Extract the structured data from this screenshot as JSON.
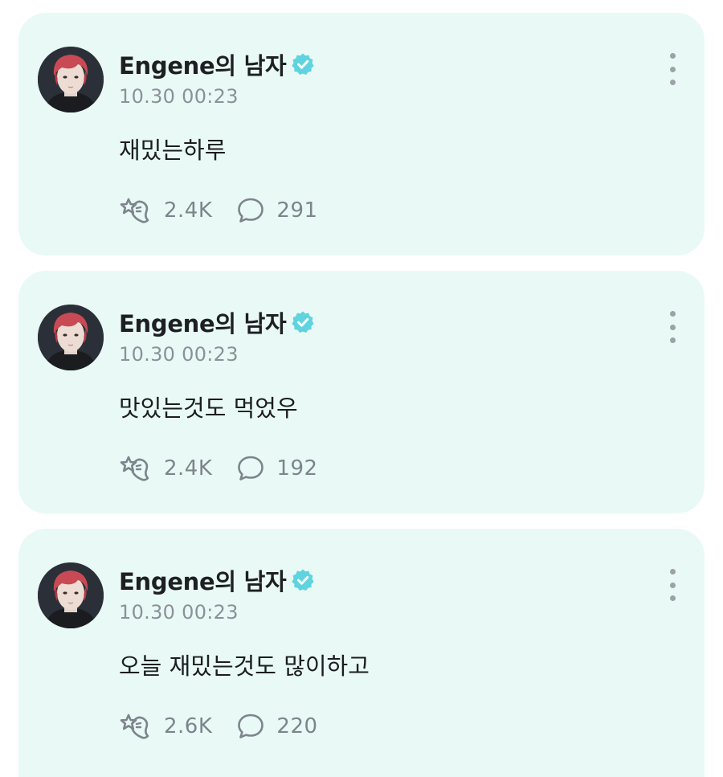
{
  "posts": [
    {
      "author": "Engene의 남자",
      "timestamp": "10.30 00:23",
      "text": "재밌는하루",
      "likes": "2.4K",
      "comments": "291"
    },
    {
      "author": "Engene의 남자",
      "timestamp": "10.30 00:23",
      "text": "맛있는것도 먹었우",
      "likes": "2.4K",
      "comments": "192"
    },
    {
      "author": "Engene의 남자",
      "timestamp": "10.30 00:23",
      "text": "오늘 재밌는것도 많이하고",
      "likes": "2.6K",
      "comments": "220"
    }
  ],
  "colors": {
    "card_background": "#e9f9f6",
    "verified_badge": "#5fd3e0",
    "muted_text": "#8a9299",
    "primary_text": "#1d1f22"
  },
  "icons": {
    "verified": "verified-badge-icon",
    "like": "star-hand-like-icon",
    "comment": "speech-bubble-icon",
    "more": "more-vertical-icon",
    "avatar": "profile-avatar"
  }
}
